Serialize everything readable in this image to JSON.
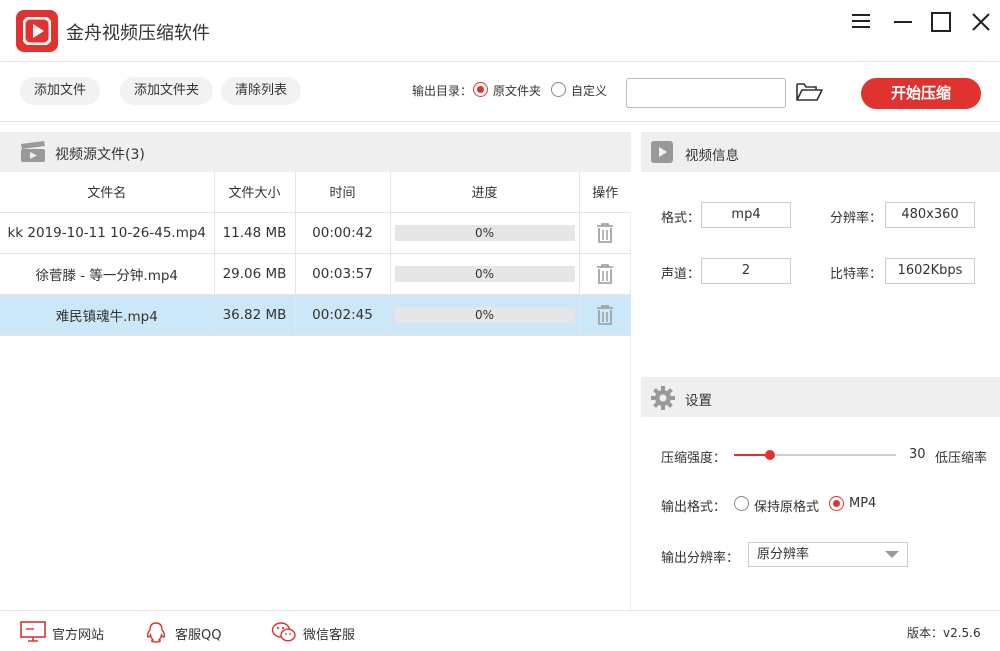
{
  "app": {
    "title": "金舟视频压缩软件"
  },
  "colors": {
    "accent": "#e0332f",
    "selected_row": "#cce8f8",
    "panel_header": "#efefef"
  },
  "toolbar": {
    "add_file": "添加文件",
    "add_folder": "添加文件夹",
    "clear_list": "清除列表",
    "output_dir_label": "输出目录：",
    "output_options": [
      "原文件夹",
      "自定义"
    ],
    "output_selected": "原文件夹",
    "path_value": "",
    "start_label": "开始压缩"
  },
  "file_panel": {
    "title": "视频源文件(3)",
    "columns": [
      "文件名",
      "文件大小",
      "时间",
      "进度",
      "操作"
    ],
    "rows": [
      {
        "name": "kk 2019-10-11 10-26-45.mp4",
        "size": "11.48 MB",
        "time": "00:00:42",
        "progress": 0,
        "progress_text": "0%"
      },
      {
        "name": "徐菅滕 - 等一分钟.mp4",
        "size": "29.06 MB",
        "time": "00:03:57",
        "progress": 0,
        "progress_text": "0%"
      },
      {
        "name": "难民镇魂牛.mp4",
        "size": "36.82 MB",
        "time": "00:02:45",
        "progress": 0,
        "progress_text": "0%"
      }
    ],
    "selected_row": 2
  },
  "video_info": {
    "title": "视频信息",
    "format_label": "格式：",
    "format_value": "mp4",
    "resolution_label": "分辨率：",
    "resolution_value": "480x360",
    "channels_label": "声道：",
    "channels_value": "2",
    "bitrate_label": "比特率：",
    "bitrate_value": "1602Kbps"
  },
  "settings": {
    "title": "设置",
    "strength_label": "压缩强度：",
    "strength_value": "30",
    "strength_fraction": 0.22,
    "strength_desc": "低压缩率",
    "format_label": "输出格式：",
    "format_options": [
      "保持原格式",
      "MP4"
    ],
    "format_selected": "MP4",
    "resolution_label": "输出分辨率：",
    "resolution_selected": "原分辨率"
  },
  "footer": {
    "website": "官方网站",
    "qq": "客服QQ",
    "wechat": "微信客服",
    "version": "版本：v2.5.6"
  }
}
